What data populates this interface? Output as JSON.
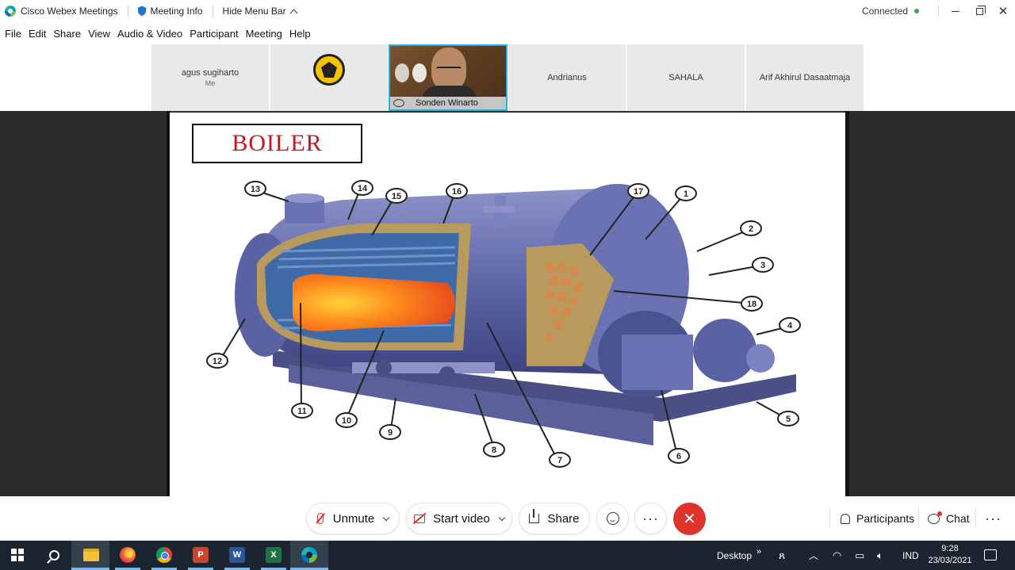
{
  "titlebar": {
    "app_name": "Cisco Webex Meetings",
    "meeting_info": "Meeting Info",
    "hide_menu": "Hide Menu Bar",
    "status": "Connected"
  },
  "menu": [
    "File",
    "Edit",
    "Share",
    "View",
    "Audio & Video",
    "Participant",
    "Meeting",
    "Help"
  ],
  "participants": [
    {
      "name": "agus sugiharto",
      "sub": "Me"
    },
    {
      "name": "",
      "sub": ""
    },
    {
      "name": "Sonden Winarto",
      "sub": ""
    },
    {
      "name": "Andrianus",
      "sub": ""
    },
    {
      "name": "SAHALA",
      "sub": ""
    },
    {
      "name": "Arif Akhirul Dasaatmaja",
      "sub": ""
    }
  ],
  "slide": {
    "title": "BOILER",
    "callouts": [
      "1",
      "2",
      "3",
      "4",
      "5",
      "6",
      "7",
      "8",
      "9",
      "10",
      "11",
      "12",
      "13",
      "14",
      "15",
      "16",
      "17",
      "18"
    ]
  },
  "controls": {
    "unmute": "Unmute",
    "start_video": "Start video",
    "share": "Share",
    "participants": "Participants",
    "chat": "Chat"
  },
  "taskbar": {
    "desktop": "Desktop",
    "lang": "IND",
    "time": "9:28",
    "date": "23/03/2021"
  },
  "colors": {
    "accent": "#22b0e8",
    "end_call": "#e0332b",
    "slide_title": "#c4161c",
    "connected": "#3ca83c"
  }
}
